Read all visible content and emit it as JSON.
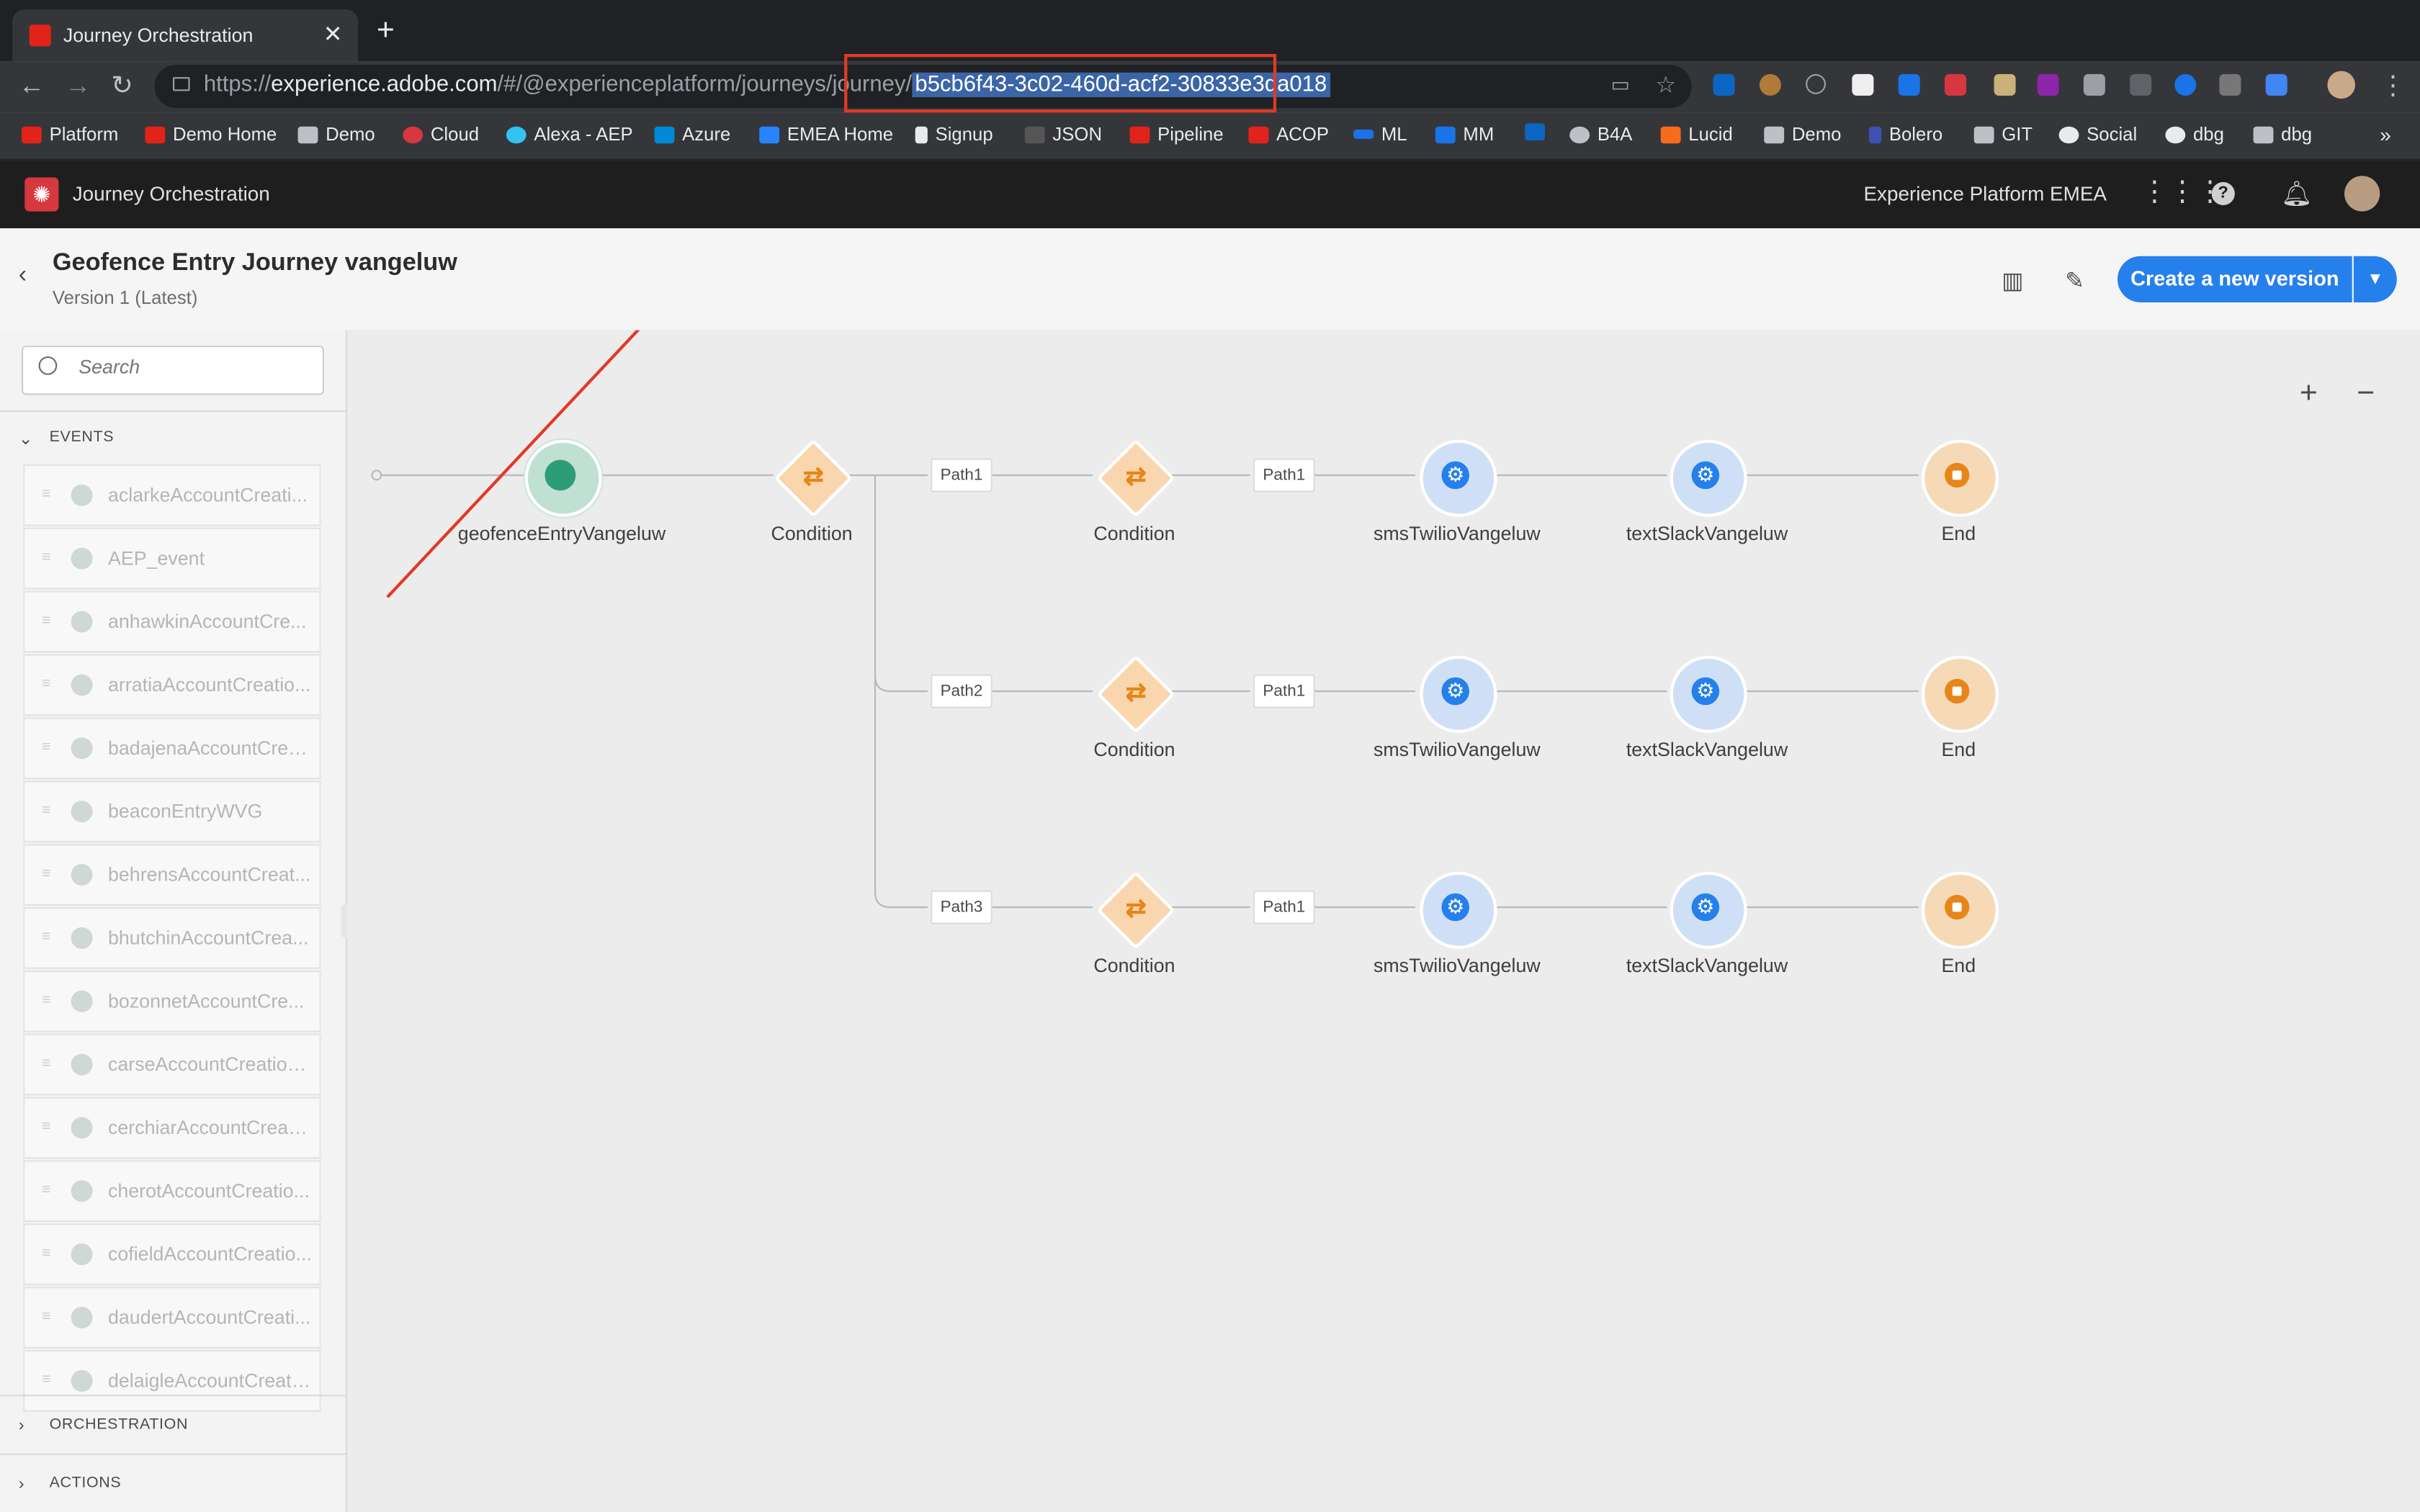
{
  "browser": {
    "tab_title": "Journey Orchestration",
    "tab_close": "✕",
    "new_tab": "+",
    "url_prefix": "https://",
    "url_host": "experience.adobe.com",
    "url_path": "/#/@experienceplatform/journeys/journey/",
    "url_selected": "b5cb6f43-3c02-460d-acf2-30833e3da018",
    "bookmarks": [
      "Platform",
      "Demo Home",
      "Demo",
      "Cloud",
      "Alexa - AEP",
      "Azure",
      "EMEA Home",
      "Signup",
      "JSON",
      "Pipeline",
      "ACOP",
      "ML",
      "MM",
      "B4A",
      "Lucid",
      "Demo",
      "Bolero",
      "GIT",
      "Social",
      "dbg",
      "dbg"
    ],
    "bookmarks_more": "»"
  },
  "app": {
    "name": "Journey Orchestration",
    "org": "Experience Platform EMEA"
  },
  "journey": {
    "title": "Geofence Entry Journey vangeluw",
    "version": "Version 1 (Latest)",
    "cta": "Create a new version"
  },
  "sidebar": {
    "search_placeholder": "Search",
    "events_label": "EVENTS",
    "events": [
      "aclarkeAccountCreati...",
      "AEP_event",
      "anhawkinAccountCre...",
      "arratiaAccountCreatio...",
      "badajenaAccountCrea...",
      "beaconEntryWVG",
      "behrensAccountCreat...",
      "bhutchinAccountCrea...",
      "bozonnetAccountCre...",
      "carseAccountCreation...",
      "cerchiarAccountCreati...",
      "cherotAccountCreatio...",
      "cofieldAccountCreatio...",
      "daudertAccountCreati...",
      "delaigleAccountCreati..."
    ],
    "orchestration_label": "ORCHESTRATION",
    "actions_label": "ACTIONS"
  },
  "canvas": {
    "zoom_in": "+",
    "zoom_out": "−",
    "entry_event": "geofenceEntryVangeluw",
    "first_condition": "Condition",
    "rows": [
      {
        "path": "Path1",
        "condition": "Condition",
        "sub_path": "Path1",
        "action1": "smsTwilioVangeluw",
        "action2": "textSlackVangeluw",
        "end": "End"
      },
      {
        "path": "Path2",
        "condition": "Condition",
        "sub_path": "Path1",
        "action1": "smsTwilioVangeluw",
        "action2": "textSlackVangeluw",
        "end": "End"
      },
      {
        "path": "Path3",
        "condition": "Condition",
        "sub_path": "Path1",
        "action1": "smsTwilioVangeluw",
        "action2": "textSlackVangeluw",
        "end": "End"
      }
    ]
  },
  "colors": {
    "accent": "#2680eb",
    "annotation": "#e03a26",
    "event_node": "#2d9d78",
    "condition_node": "#e68619"
  }
}
